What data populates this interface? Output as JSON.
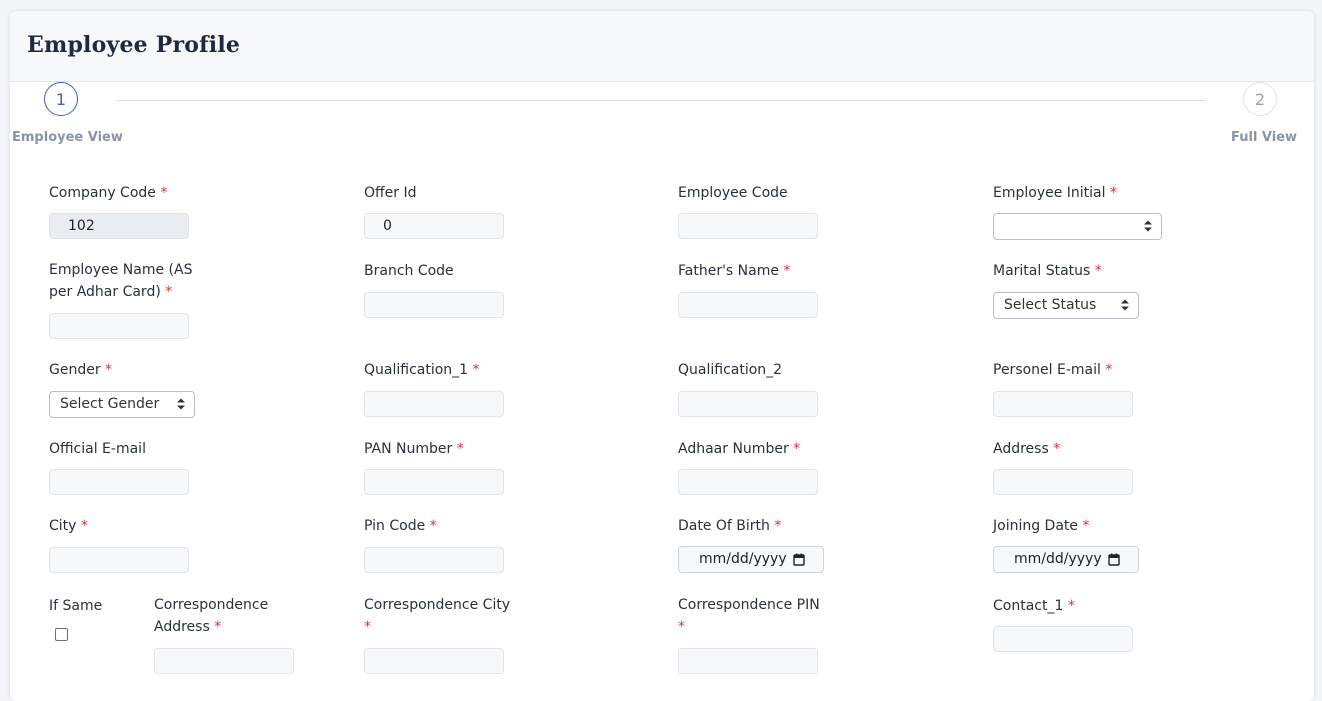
{
  "page": {
    "title": "Employee Profile"
  },
  "stepper": {
    "steps": [
      {
        "number": "1",
        "label": "Employee View"
      },
      {
        "number": "2",
        "label": "Full View"
      }
    ]
  },
  "required_mark": "*",
  "form": {
    "company_code": {
      "label": "Company Code",
      "value": "102"
    },
    "offer_id": {
      "label": "Offer Id",
      "value": "0"
    },
    "employee_code": {
      "label": "Employee Code",
      "value": ""
    },
    "employee_initial": {
      "label": "Employee Initial",
      "value": ""
    },
    "employee_name": {
      "label_line1": "Employee Name (AS",
      "label_line2": "per Adhar Card)",
      "value": ""
    },
    "branch_code": {
      "label": "Branch Code",
      "value": ""
    },
    "fathers_name": {
      "label": "Father's Name",
      "value": ""
    },
    "marital_status": {
      "label": "Marital Status",
      "value": "Select Status"
    },
    "gender": {
      "label": "Gender",
      "value": "Select Gender"
    },
    "qualification_1": {
      "label": "Qualification_1",
      "value": ""
    },
    "qualification_2": {
      "label": "Qualification_2",
      "value": ""
    },
    "personal_email": {
      "label": "Personel E-mail",
      "value": ""
    },
    "official_email": {
      "label": "Official E-mail",
      "value": ""
    },
    "pan_number": {
      "label": "PAN Number",
      "value": ""
    },
    "adhaar_number": {
      "label": "Adhaar Number",
      "value": ""
    },
    "address": {
      "label": "Address",
      "value": ""
    },
    "city": {
      "label": "City",
      "value": ""
    },
    "pin_code": {
      "label": "Pin Code",
      "value": ""
    },
    "date_of_birth": {
      "label": "Date Of Birth",
      "value": "mm/dd/yyyy"
    },
    "joining_date": {
      "label": "Joining Date",
      "value": "mm/dd/yyyy"
    },
    "if_same": {
      "label": "If Same",
      "checked": false
    },
    "correspondence_address": {
      "label_line1": "Correspondence",
      "label_line2": "Address",
      "value": ""
    },
    "correspondence_city": {
      "label": "Correspondence City",
      "value": ""
    },
    "correspondence_pin": {
      "label": "Correspondence PIN",
      "value": ""
    },
    "contact_1": {
      "label": "Contact_1",
      "value": ""
    }
  }
}
